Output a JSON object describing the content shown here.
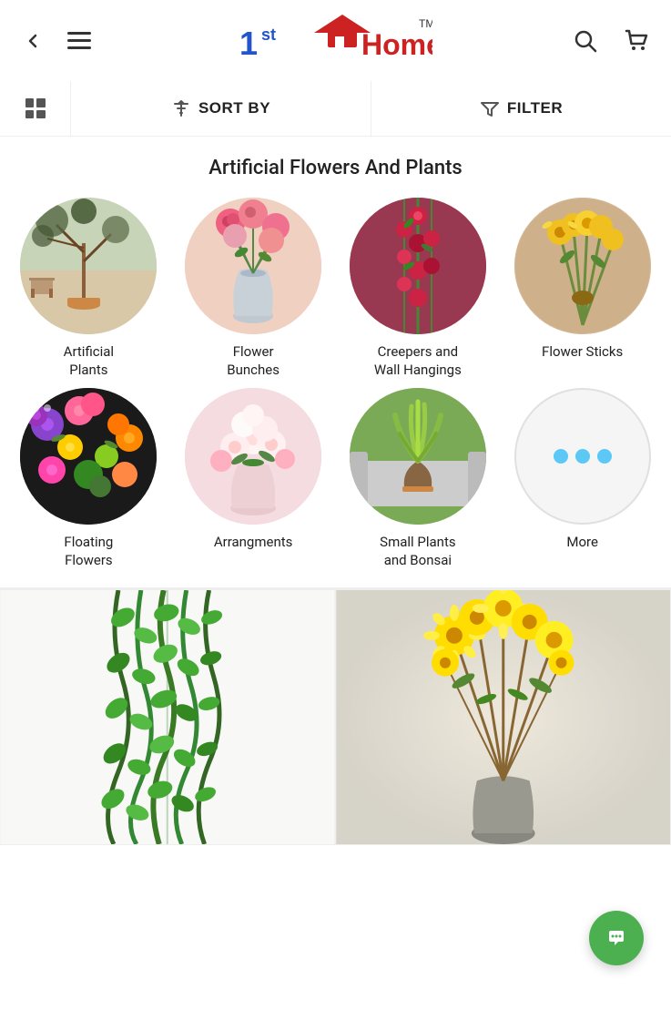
{
  "header": {
    "back_label": "Back",
    "menu_label": "Menu",
    "logo_1st": "1",
    "logo_st": "st",
    "logo_home": "Home",
    "logo_tm": "TM",
    "search_label": "Search",
    "cart_label": "Cart"
  },
  "toolbar": {
    "sort_label": "SORT BY",
    "filter_label": "FILTER",
    "grid_label": "Grid View"
  },
  "page": {
    "title": "Artificial Flowers And Plants"
  },
  "categories": [
    {
      "id": "artificial-plants",
      "label": "Artificial\nPlants",
      "label_line1": "Artificial",
      "label_line2": "Plants"
    },
    {
      "id": "flower-bunches",
      "label": "Flower\nBunches",
      "label_line1": "Flower",
      "label_line2": "Bunches"
    },
    {
      "id": "creepers-wall-hangings",
      "label": "Creepers and\nWall Hangings",
      "label_line1": "Creepers and",
      "label_line2": "Wall Hangings"
    },
    {
      "id": "flower-sticks",
      "label": "Flower Sticks",
      "label_line1": "Flower Sticks",
      "label_line2": ""
    },
    {
      "id": "floating-flowers",
      "label": "Floating\nFlowers",
      "label_line1": "Floating",
      "label_line2": "Flowers"
    },
    {
      "id": "arrangements",
      "label": "Arrangments",
      "label_line1": "Arrangments",
      "label_line2": ""
    },
    {
      "id": "small-plants-bonsai",
      "label": "Small Plants\nand Bonsai",
      "label_line1": "Small Plants",
      "label_line2": "and Bonsai"
    },
    {
      "id": "more",
      "label": "More",
      "label_line1": "More",
      "label_line2": "",
      "is_more": true
    }
  ],
  "products": [
    {
      "id": "product-1",
      "type": "hanging-vine"
    },
    {
      "id": "product-2",
      "type": "flower-arrangement"
    }
  ],
  "chat": {
    "label": "Chat"
  },
  "colors": {
    "accent_blue": "#2255cc",
    "accent_red": "#cc2222",
    "sort_icon_color": "#555",
    "filter_icon_color": "#555",
    "chat_green": "#4caf50",
    "dot_blue": "#5bc8f5"
  }
}
